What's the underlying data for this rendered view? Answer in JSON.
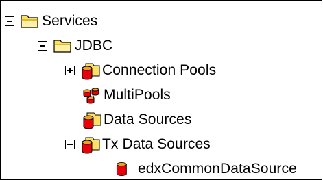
{
  "tree": {
    "nodes": [
      {
        "label": "Services",
        "icon": "folder-icon",
        "toggle": "minus"
      },
      {
        "label": "JDBC",
        "icon": "folder-icon",
        "toggle": "minus"
      },
      {
        "label": "Connection Pools",
        "icon": "connection-pool-icon",
        "toggle": "plus"
      },
      {
        "label": "MultiPools",
        "icon": "multipool-icon",
        "toggle": "none"
      },
      {
        "label": "Data Sources",
        "icon": "datasource-stack-icon",
        "toggle": "none"
      },
      {
        "label": "Tx Data Sources",
        "icon": "datasource-stack-icon",
        "toggle": "minus"
      },
      {
        "label": "edxCommonDataSource",
        "icon": "database-cylinder-icon",
        "toggle": "none"
      }
    ]
  },
  "colors": {
    "folder_yellow": "#FFE066",
    "cylinder_red": "#E8000A",
    "cylinder_orange": "#F0A020"
  }
}
